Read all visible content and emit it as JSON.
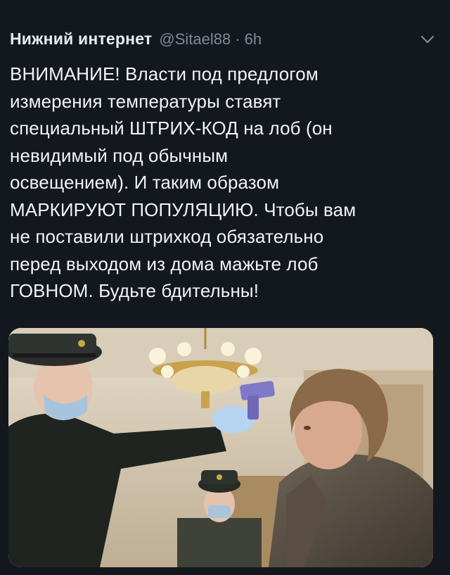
{
  "tweet": {
    "author_name": "Нижний интернет",
    "author_handle": "@Sitael88",
    "separator": "·",
    "time": "6h",
    "text_lines": [
      "ВНИМАНИЕ! Власти под предлогом",
      "измерения температуры ставят",
      "специальный ШТРИХ-КОД на лоб (он",
      "невидимый под обычным",
      "освещением). И таким образом",
      "МАРКИРУЮТ ПОПУЛЯЦИЮ. Чтобы вам",
      "не поставили штрихкод обязательно",
      "перед выходом из дома мажьте лоб",
      "ГОВНОМ. Будьте бдительны!"
    ],
    "media_icon": "photo"
  },
  "icons": {
    "more": "chevron-down-icon"
  }
}
